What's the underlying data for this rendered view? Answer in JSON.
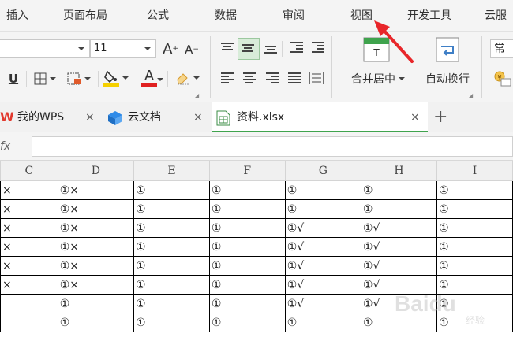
{
  "menu": {
    "items": [
      "插入",
      "页面布局",
      "公式",
      "数据",
      "审阅",
      "视图",
      "开发工具",
      "云服"
    ]
  },
  "ribbon": {
    "font_size": "11",
    "font_grow": "A",
    "font_shrink": "A",
    "underline": "U",
    "font_color_letter": "A",
    "highlight_color": "#f5d000",
    "font_color": "#e02020",
    "merge_center_label": "合并居中",
    "wrap_text_label": "自动换行",
    "number_format": "常",
    "cell_style_icon": "T"
  },
  "tabs": [
    {
      "label": "我的WPS",
      "icon": "wps-logo-icon"
    },
    {
      "label": "云文档",
      "icon": "cloud-doc-icon"
    },
    {
      "label": "资料.xlsx",
      "icon": "spreadsheet-file-icon",
      "active": true
    }
  ],
  "tab_add": "+",
  "tab_close": "×",
  "formula_bar": {
    "fx_label": "fx",
    "value": ""
  },
  "sheet": {
    "columns": [
      "C",
      "D",
      "E",
      "F",
      "G",
      "H",
      "I"
    ],
    "rows": [
      [
        "×",
        "①×",
        "①",
        "①",
        "①",
        "①",
        "①"
      ],
      [
        "×",
        "①×",
        "①",
        "①",
        "①",
        "①",
        "①"
      ],
      [
        "×",
        "①×",
        "①",
        "①",
        "①√",
        "①√",
        "①"
      ],
      [
        "×",
        "①×",
        "①",
        "①",
        "①√",
        "①√",
        "①"
      ],
      [
        "×",
        "①×",
        "①",
        "①",
        "①√",
        "①√",
        "①"
      ],
      [
        "×",
        "①×",
        "①",
        "①",
        "①√",
        "①√",
        "①"
      ],
      [
        "",
        "①",
        "①",
        "①",
        "①√",
        "①√",
        "①"
      ],
      [
        "",
        "①",
        "①",
        "①",
        "①",
        "①",
        "①"
      ]
    ]
  },
  "annotation": {
    "color": "#e8262a",
    "target": "视图"
  },
  "watermark": {
    "text": "Baidu",
    "sub": "经验"
  }
}
